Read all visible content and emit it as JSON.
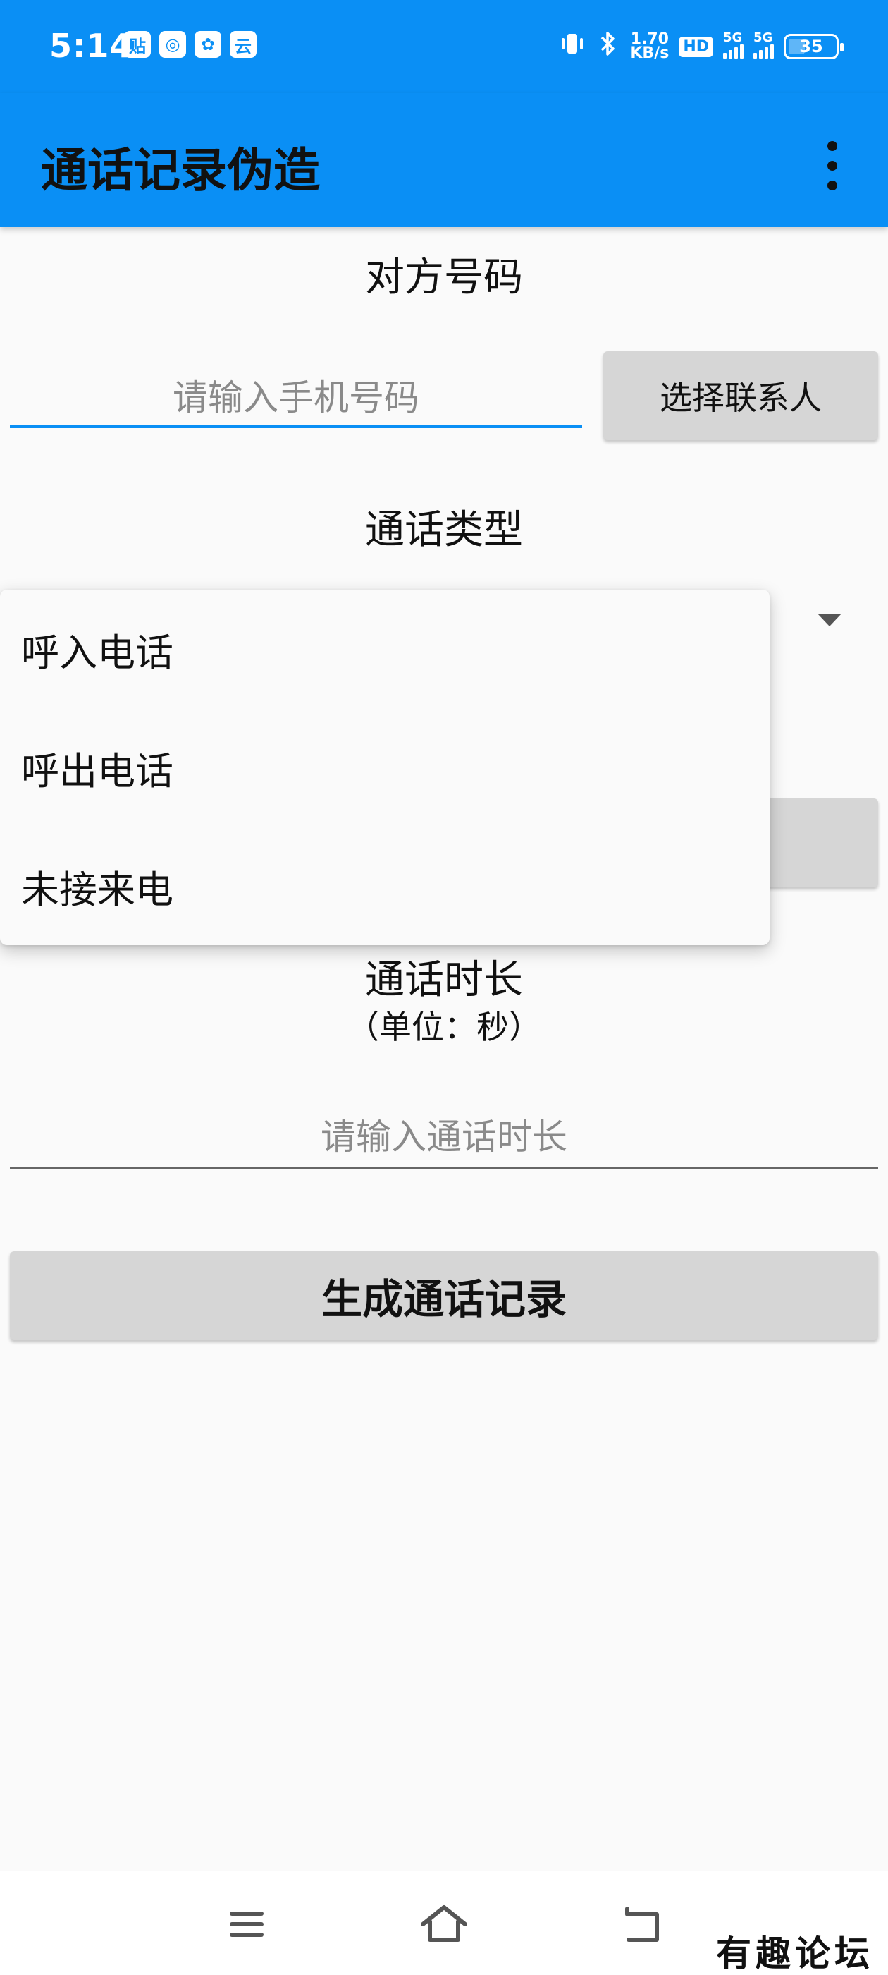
{
  "status_bar": {
    "time": "5:14",
    "app_icons": [
      "贴",
      "◎",
      "✿",
      "云"
    ],
    "net_speed_value": "1.70",
    "net_speed_unit": "KB/s",
    "hd_label": "HD",
    "network_label_1": "5G",
    "network_label_2": "5G",
    "battery_percent": "35",
    "battery_level": 0.35,
    "vibrate_icon": "vibrate-icon",
    "bluetooth_icon": "bluetooth-icon"
  },
  "app_bar": {
    "title": "通话记录伪造",
    "menu_icon": "more-vert-icon"
  },
  "form": {
    "phone_label": "对方号码",
    "phone_placeholder": "请输入手机号码",
    "phone_value": "",
    "select_contact_button": "选择联系人",
    "call_type_label": "通话类型",
    "duration_label": "通话时长",
    "duration_unit": "（单位：秒）",
    "duration_placeholder": "请输入通话时长",
    "duration_value": "",
    "generate_button": "生成通话记录"
  },
  "call_type_dropdown": {
    "expanded": true,
    "options": [
      "呼入电话",
      "呼出电话",
      "未接来电"
    ]
  },
  "nav_bar": {
    "menu_icon": "menu-icon",
    "home_icon": "home-icon",
    "back_icon": "back-icon"
  },
  "watermark": "有趣论坛",
  "colors": {
    "primary": "#0a8ff5",
    "button_grey": "#d6d6d6",
    "background": "#fafafa"
  }
}
